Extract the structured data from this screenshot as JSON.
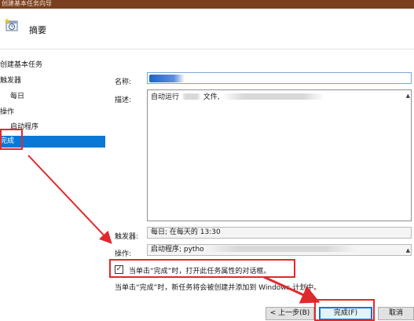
{
  "window": {
    "title": "创建基本任务向导"
  },
  "header": {
    "title": "摘要",
    "icon": "task-clock-icon"
  },
  "nav": {
    "items": [
      {
        "label": "创建基本任务",
        "active": false
      },
      {
        "label": "触发器",
        "active": false
      },
      {
        "label": "每日",
        "active": false
      },
      {
        "label": "操作",
        "active": false
      },
      {
        "label": "启动程序",
        "active": false
      },
      {
        "label": "完成",
        "active": true
      }
    ]
  },
  "form": {
    "name_label": "名称:",
    "name_value": "",
    "description_label": "描述:",
    "description_prefix": "自动运行",
    "description_mid": "文件,",
    "trigger_label": "触发器:",
    "trigger_value": "每日; 在每天的 13:30",
    "action_label": "操作:",
    "action_value": "启动程序; pytho"
  },
  "options": {
    "open_properties_label": "当单击“完成”时，打开此任务属性的对话框。",
    "open_properties_checked": true,
    "note": "当单击“完成”时，新任务将会被创建并添加到 Windows 计划中。",
    "check_mark": "✓"
  },
  "buttons": {
    "back": "< 上一步(B)",
    "finish": "完成(F)",
    "cancel": "取消"
  },
  "colors": {
    "annotation_red": "#e0292d",
    "selection_blue": "#0a78d7",
    "title_bar": "#7a3f1e"
  }
}
